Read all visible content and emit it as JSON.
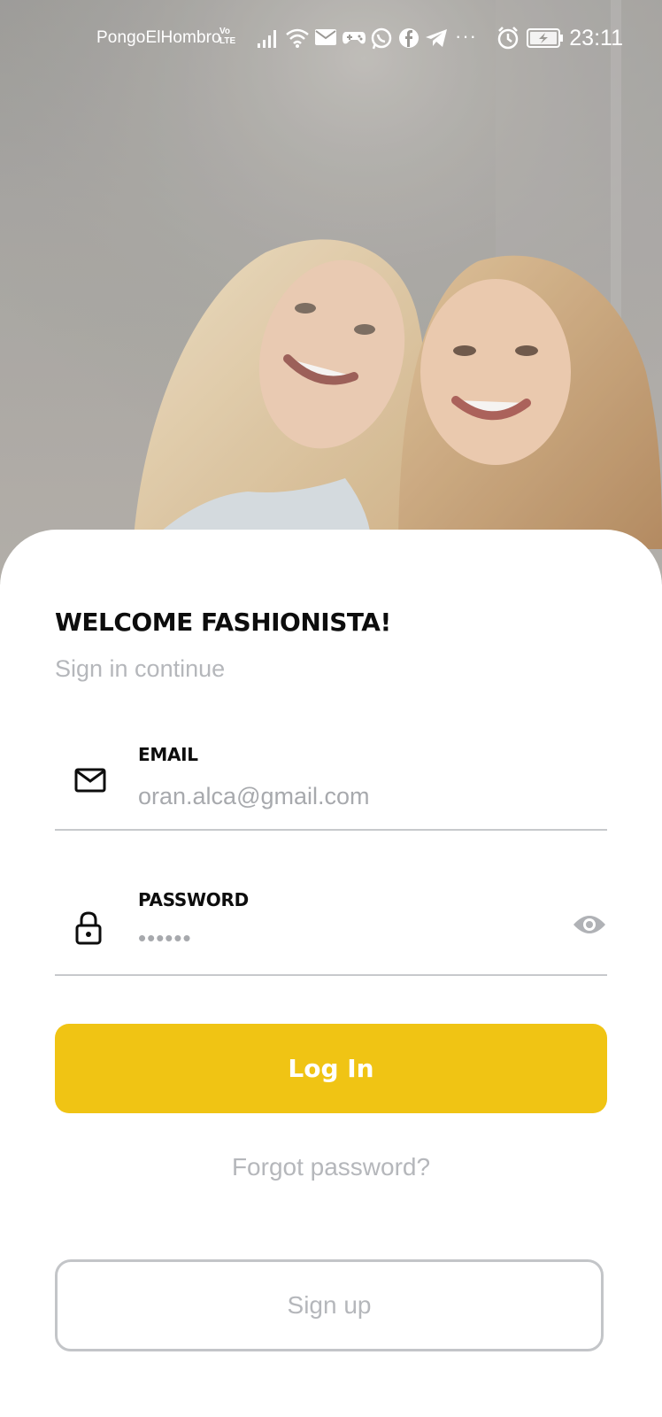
{
  "status_bar": {
    "carrier": "PongoElHombro",
    "volte_top": "Vo",
    "volte_bottom": "LTE",
    "more": "···",
    "time": "23:11",
    "icons": [
      "signal-icon",
      "wifi-icon",
      "mail-notification-icon",
      "gamepad-icon",
      "whatsapp-icon",
      "facebook-icon",
      "telegram-icon",
      "alarm-icon",
      "battery-charging-icon"
    ]
  },
  "hero": {
    "image": "two-smiling-women-photo"
  },
  "login": {
    "title": "WELCOME FASHIONISTA!",
    "subtitle": "Sign in continue",
    "email": {
      "label": "EMAIL",
      "value": "oran.alca@gmail.com",
      "icon": "mail-icon"
    },
    "password": {
      "label": "PASSWORD",
      "value": "••••••",
      "icon": "lock-icon",
      "toggle_icon": "eye-icon"
    },
    "login_button": "Log In",
    "forgot_link": "Forgot password?",
    "signup_button": "Sign up"
  },
  "colors": {
    "accent": "#f0c414",
    "muted_text": "#b5b7bb",
    "divider": "#c7c9cc",
    "dark_text": "#0d0d0d"
  }
}
